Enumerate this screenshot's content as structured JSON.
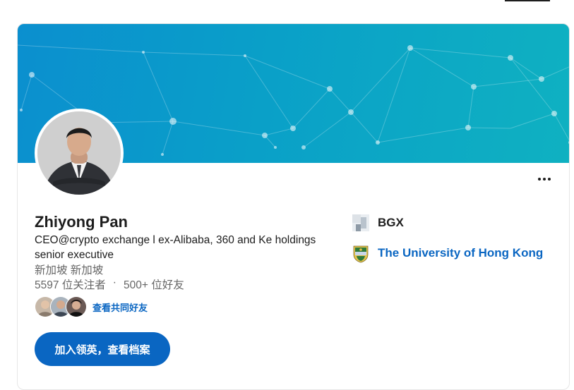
{
  "profile": {
    "name": "Zhiyong Pan",
    "headline": "CEO@crypto exchange l ex-Alibaba, 360 and Ke holdings senior executive",
    "location": "新加坡 新加坡",
    "followers": "5597 位关注者",
    "separator": "·",
    "connections": "500+ 位好友",
    "mutual_link": "查看共同好友",
    "join_button": "加入领英，查看档案"
  },
  "sidebar": {
    "company": {
      "label": "BGX",
      "icon": "company-logo-icon"
    },
    "school": {
      "label": "The University of Hong Kong",
      "icon": "hku-crest-icon"
    }
  },
  "colors": {
    "primary": "#0a66c2",
    "banner_start": "#0b8fcf",
    "banner_end": "#0fb1c1"
  },
  "icons": {
    "more": "more-horizontal-icon"
  }
}
